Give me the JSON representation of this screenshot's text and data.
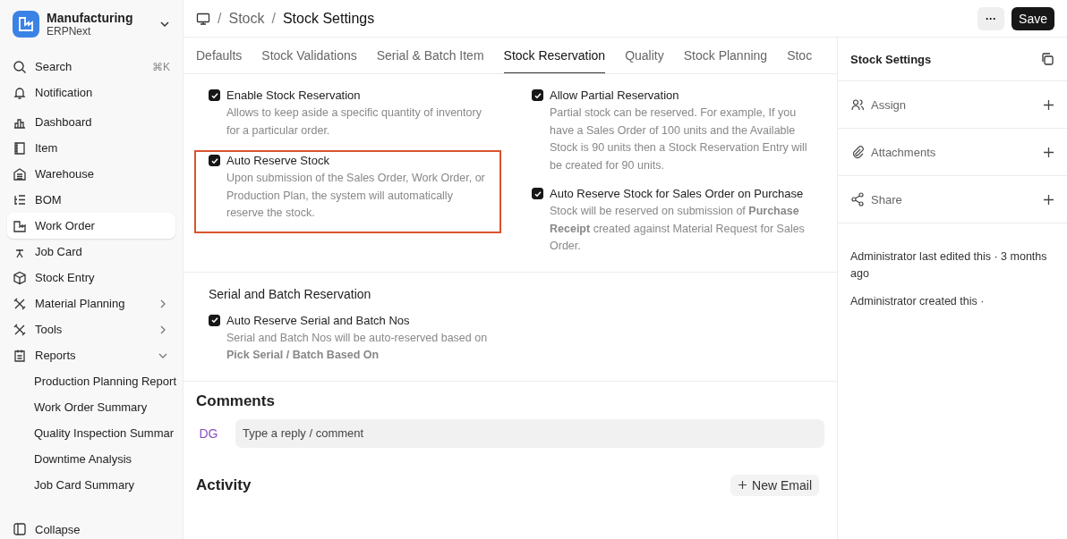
{
  "app": {
    "name": "Manufacturing",
    "subtitle": "ERPNext"
  },
  "sidebar": {
    "search": {
      "label": "Search",
      "shortcut": "⌘K"
    },
    "items": [
      {
        "label": "Notification",
        "selected": false
      },
      {
        "label": "Dashboard",
        "selected": false
      },
      {
        "label": "Item",
        "selected": false
      },
      {
        "label": "Warehouse",
        "selected": false
      },
      {
        "label": "BOM",
        "selected": false
      },
      {
        "label": "Work Order",
        "selected": true
      },
      {
        "label": "Job Card",
        "selected": false
      },
      {
        "label": "Stock Entry",
        "selected": false
      },
      {
        "label": "Material Planning",
        "selected": false,
        "kind": "group",
        "expanded": false
      },
      {
        "label": "Tools",
        "selected": false,
        "kind": "group",
        "expanded": false
      },
      {
        "label": "Reports",
        "selected": false,
        "kind": "group",
        "expanded": true,
        "children": [
          {
            "label": "Production Planning Report"
          },
          {
            "label": "Work Order Summary"
          },
          {
            "label": "Quality Inspection Summar"
          },
          {
            "label": "Downtime Analysis"
          },
          {
            "label": "Job Card Summary"
          }
        ]
      }
    ],
    "collapse": "Collapse"
  },
  "breadcrumb": [
    {
      "separator": "/",
      "label": "Stock"
    },
    {
      "separator": "/",
      "label": "Stock Settings"
    }
  ],
  "actions": {
    "more": "···",
    "save": "Save"
  },
  "tabs": [
    {
      "label": "Defaults",
      "selected": false
    },
    {
      "label": "Stock Validations",
      "selected": false
    },
    {
      "label": "Serial & Batch Item",
      "selected": false
    },
    {
      "label": "Stock Reservation",
      "selected": true
    },
    {
      "label": "Quality",
      "selected": false
    },
    {
      "label": "Stock Planning",
      "selected": false
    },
    {
      "label": "Stoc",
      "selected": false
    }
  ],
  "sections": [
    {
      "columns": [
        [
          {
            "kind": "checkbox",
            "label": "Enable Stock Reservation",
            "checked": true,
            "highlighted": false,
            "description": "Allows to keep aside a specific quantity of inventory for a particular order."
          },
          {
            "kind": "checkbox",
            "label": "Auto Reserve Stock",
            "checked": true,
            "highlighted": true,
            "description": "Upon submission of the Sales Order, Work Order, or Production Plan, the system will automatically reserve the stock."
          }
        ],
        [
          {
            "kind": "checkbox",
            "label": "Allow Partial Reservation",
            "checked": true,
            "highlighted": false,
            "description": "Partial stock can be reserved. For example, If you have a Sales Order of 100 units and the Available Stock is 90 units then a Stock Reservation Entry will be created for 90 units."
          },
          {
            "kind": "checkbox",
            "label": "Auto Reserve Stock for Sales Order on Purchase",
            "checked": true,
            "highlighted": false,
            "description": "Stock will be reserved on submission of **Purchase Receipt** created against Material Request for Sales Order."
          }
        ]
      ]
    },
    {
      "title": "Serial and Batch Reservation",
      "columns": [
        [
          {
            "kind": "checkbox",
            "label": "Auto Reserve Serial and Batch Nos",
            "checked": true,
            "highlighted": false,
            "description": "Serial and Batch Nos will be auto-reserved based on **Pick Serial / Batch Based On**"
          }
        ]
      ]
    }
  ],
  "comments": {
    "title": "Comments",
    "avatar": "DG",
    "placeholder": "Type a reply / comment"
  },
  "activity": {
    "title": "Activity",
    "button": "New Email"
  },
  "side_panel": {
    "title": "Stock Settings",
    "rows": [
      {
        "label": "Assign"
      },
      {
        "label": "Attachments"
      },
      {
        "label": "Share"
      }
    ],
    "log": [
      "Administrator last edited this · 3 months ago",
      "Administrator created this ·"
    ]
  }
}
